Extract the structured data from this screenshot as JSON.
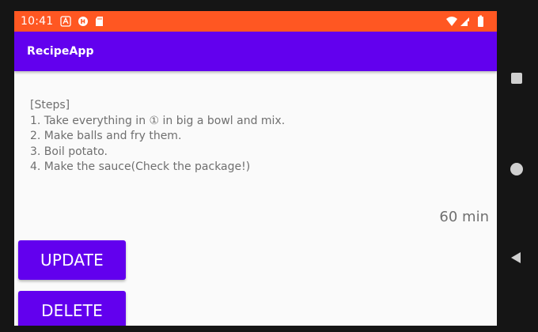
{
  "status_bar": {
    "time": "10:41",
    "color": "#ff5722",
    "icons_left": [
      "a-notification-icon",
      "app-notification-icon",
      "sd-card-icon"
    ],
    "icons_right": [
      "wifi-icon",
      "cell-signal-icon",
      "battery-icon"
    ]
  },
  "app_bar": {
    "title": "RecipeApp",
    "color": "#6200ee"
  },
  "content": {
    "steps_text": "[Steps]\n1. Take everything in ① in big a bowl and mix.\n2. Make balls and fry them.\n3. Boil potato.\n4. Make the sauce(Check the package!)",
    "time": "60 min"
  },
  "buttons": {
    "update": "UPDATE",
    "delete": "DELETE"
  },
  "navigation": {
    "items": [
      "overview-icon",
      "home-icon",
      "back-icon"
    ]
  }
}
